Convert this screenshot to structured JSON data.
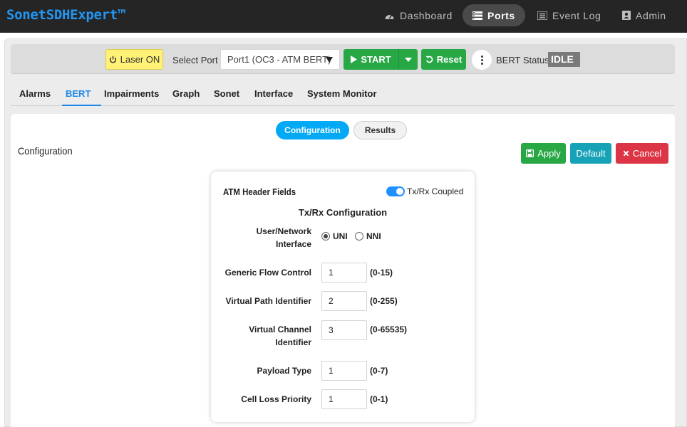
{
  "app": {
    "brand": "SonetSDHExpert™"
  },
  "nav": [
    {
      "label": "Dashboard",
      "icon": "dashboard-icon"
    },
    {
      "label": "Ports",
      "icon": "ports-icon",
      "active": true
    },
    {
      "label": "Event Log",
      "icon": "event-log-icon"
    },
    {
      "label": "Admin",
      "icon": "admin-icon"
    }
  ],
  "toolbar": {
    "laser_label": "Laser ON",
    "select_port_label": "Select Port",
    "port_value": "Port1 (OC3 - ATM BERT)",
    "start_label": "START",
    "reset_label": "Reset",
    "bert_status_label": "BERT Status",
    "bert_status_value": "IDLE"
  },
  "tabs": [
    "Alarms",
    "BERT",
    "Impairments",
    "Graph",
    "Sonet",
    "Interface",
    "System Monitor"
  ],
  "active_tab": "BERT",
  "subtabs": {
    "configuration": "Configuration",
    "results": "Results"
  },
  "section": {
    "title": "Configuration",
    "apply_label": "Apply",
    "default_label": "Default",
    "cancel_label": "Cancel"
  },
  "panel": {
    "title": "ATM Header Fields",
    "toggle_label": "Tx/Rx Coupled",
    "toggle_on": true,
    "subheading": "Tx/Rx Configuration",
    "interface": {
      "label_line1": "User/Network",
      "label_line2": "Interface",
      "options": [
        "UNI",
        "NNI"
      ],
      "selected": "UNI"
    },
    "fields": {
      "gfc": {
        "label": "Generic Flow Control",
        "value": "1",
        "range": "(0-15)"
      },
      "vpi": {
        "label": "Virtual Path Identifier",
        "value": "2",
        "range": "(0-255)"
      },
      "vci": {
        "label_line1": "Virtual Channel",
        "label_line2": "Identifier",
        "value": "3",
        "range": "(0-65535)"
      },
      "pt": {
        "label": "Payload Type",
        "value": "1",
        "range": "(0-7)"
      },
      "clp": {
        "label": "Cell Loss Priority",
        "value": "1",
        "range": "(0-1)"
      }
    }
  },
  "colors": {
    "brand": "#2196f3",
    "success": "#28a745",
    "info": "#17a2b8",
    "danger": "#dc3545",
    "primary_pill": "#03a9f4",
    "laser": "#fff176",
    "alert": "#e53935"
  }
}
